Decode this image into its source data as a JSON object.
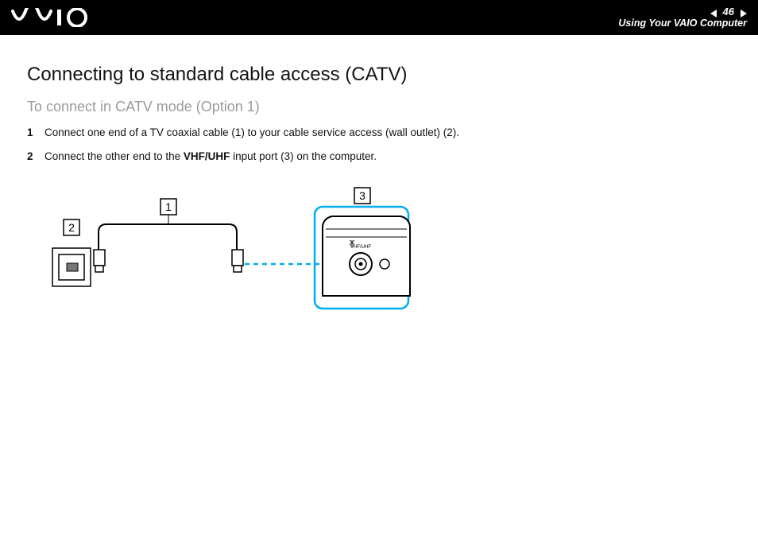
{
  "header": {
    "page_number": "46",
    "section_title": "Using Your VAIO Computer"
  },
  "content": {
    "heading": "Connecting to standard cable access (CATV)",
    "subheading": "To connect in CATV mode (Option 1)",
    "steps": [
      {
        "pre": "Connect one end of a TV coaxial cable (1) to your cable service access (wall outlet) (2).",
        "bold": "",
        "post": ""
      },
      {
        "pre": "Connect the other end to the ",
        "bold": "VHF/UHF",
        "post": " input port (3) on the computer."
      }
    ],
    "diagram_labels": {
      "a": "1",
      "b": "2",
      "c": "3"
    }
  }
}
